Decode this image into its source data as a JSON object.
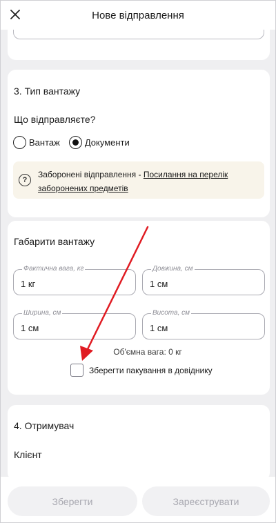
{
  "header": {
    "title": "Нове відправлення",
    "close_icon": "close-icon"
  },
  "cargo_type": {
    "section_title": "3. Тип вантажу",
    "question": "Що відправляєте?",
    "options": [
      {
        "label": "Вантаж",
        "selected": false
      },
      {
        "label": "Документи",
        "selected": true
      }
    ],
    "notice": {
      "icon": "question-circle-icon",
      "text": "Заборонені відправлення - ",
      "link": "Посилання на перелік заборонених предметів",
      "background": "#f8f4ea"
    }
  },
  "dimensions": {
    "title": "Габарити вантажу",
    "fields": [
      {
        "label": "Фактична вага, кг",
        "value": "1 кг"
      },
      {
        "label": "Довжина, см",
        "value": "1 см"
      },
      {
        "label": "Ширина, см",
        "value": "1 см"
      },
      {
        "label": "Висота, см",
        "value": "1 см"
      }
    ],
    "volume_weight": "Об'ємна вага: 0 кг",
    "save_packaging": {
      "label": "Зберегти пакування в довіднику",
      "checked": false
    }
  },
  "recipient": {
    "title": "4. Отримувач",
    "client_label": "Клієнт"
  },
  "footer": {
    "save_button": "Зберегти",
    "register_button": "Зареєструвати"
  },
  "annotation": {
    "color": "#e01b22"
  }
}
